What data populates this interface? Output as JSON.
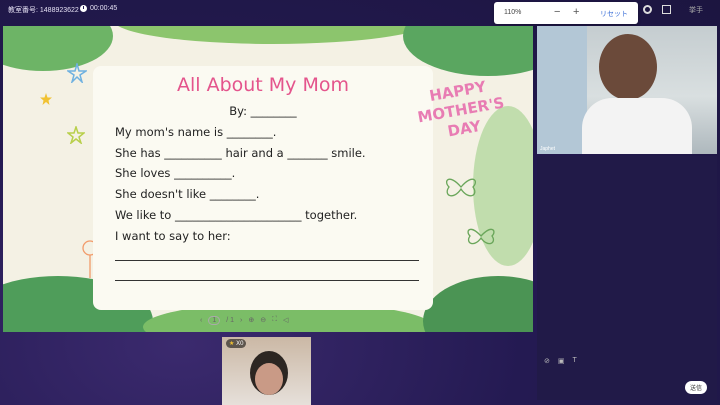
{
  "topbar": {
    "room_id": "教室番号: 1488923622",
    "timer": "00:00:45",
    "zoom": {
      "value": "110%",
      "minus": "−",
      "plus": "+",
      "reset": "リセット"
    },
    "raise_hand": "挙手"
  },
  "slide": {
    "title": "All About My Mom",
    "lines": [
      "By: ________",
      "My mom's name is ________.",
      "She has __________ hair and a _______ smile.",
      "She loves __________.",
      "She doesn't like ________.",
      "We like to ______________________ together.",
      "I want to say to her:"
    ],
    "badge": [
      "HAPPY",
      "MOTHER'S",
      "DAY"
    ],
    "pager": {
      "prev": "‹",
      "page": "1",
      "sep": "/ 1",
      "next": "›"
    }
  },
  "teacher": {
    "name": "Japhet"
  },
  "student": {
    "stars": "X0"
  },
  "chat": {
    "send_label": "送信"
  },
  "colors": {
    "title_pink": "#e4548c",
    "badge_pink": "#e87cb3",
    "background": "#241a52"
  }
}
